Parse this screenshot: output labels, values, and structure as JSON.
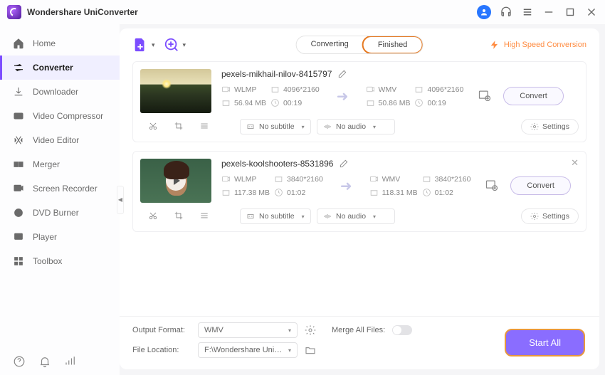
{
  "app": {
    "title": "Wondershare UniConverter"
  },
  "sidebar": {
    "items": [
      {
        "label": "Home"
      },
      {
        "label": "Converter"
      },
      {
        "label": "Downloader"
      },
      {
        "label": "Video Compressor"
      },
      {
        "label": "Video Editor"
      },
      {
        "label": "Merger"
      },
      {
        "label": "Screen Recorder"
      },
      {
        "label": "DVD Burner"
      },
      {
        "label": "Player"
      },
      {
        "label": "Toolbox"
      }
    ]
  },
  "tabs": {
    "converting": "Converting",
    "finished": "Finished"
  },
  "highspeed": "High Speed Conversion",
  "files": [
    {
      "name": "pexels-mikhail-nilov-8415797",
      "in": {
        "fmt": "WLMP",
        "res": "4096*2160",
        "size": "56.94 MB",
        "dur": "00:19"
      },
      "out": {
        "fmt": "WMV",
        "res": "4096*2160",
        "size": "50.86 MB",
        "dur": "00:19"
      },
      "subtitle": "No subtitle",
      "audio": "No audio",
      "convert": "Convert",
      "settings": "Settings"
    },
    {
      "name": "pexels-koolshooters-8531896",
      "in": {
        "fmt": "WLMP",
        "res": "3840*2160",
        "size": "117.38 MB",
        "dur": "01:02"
      },
      "out": {
        "fmt": "WMV",
        "res": "3840*2160",
        "size": "118.31 MB",
        "dur": "01:02"
      },
      "subtitle": "No subtitle",
      "audio": "No audio",
      "convert": "Convert",
      "settings": "Settings"
    }
  ],
  "bottom": {
    "output_format_label": "Output Format:",
    "output_format_value": "WMV",
    "merge_label": "Merge All Files:",
    "location_label": "File Location:",
    "location_value": "F:\\Wondershare UniConverter",
    "start_all": "Start All"
  }
}
